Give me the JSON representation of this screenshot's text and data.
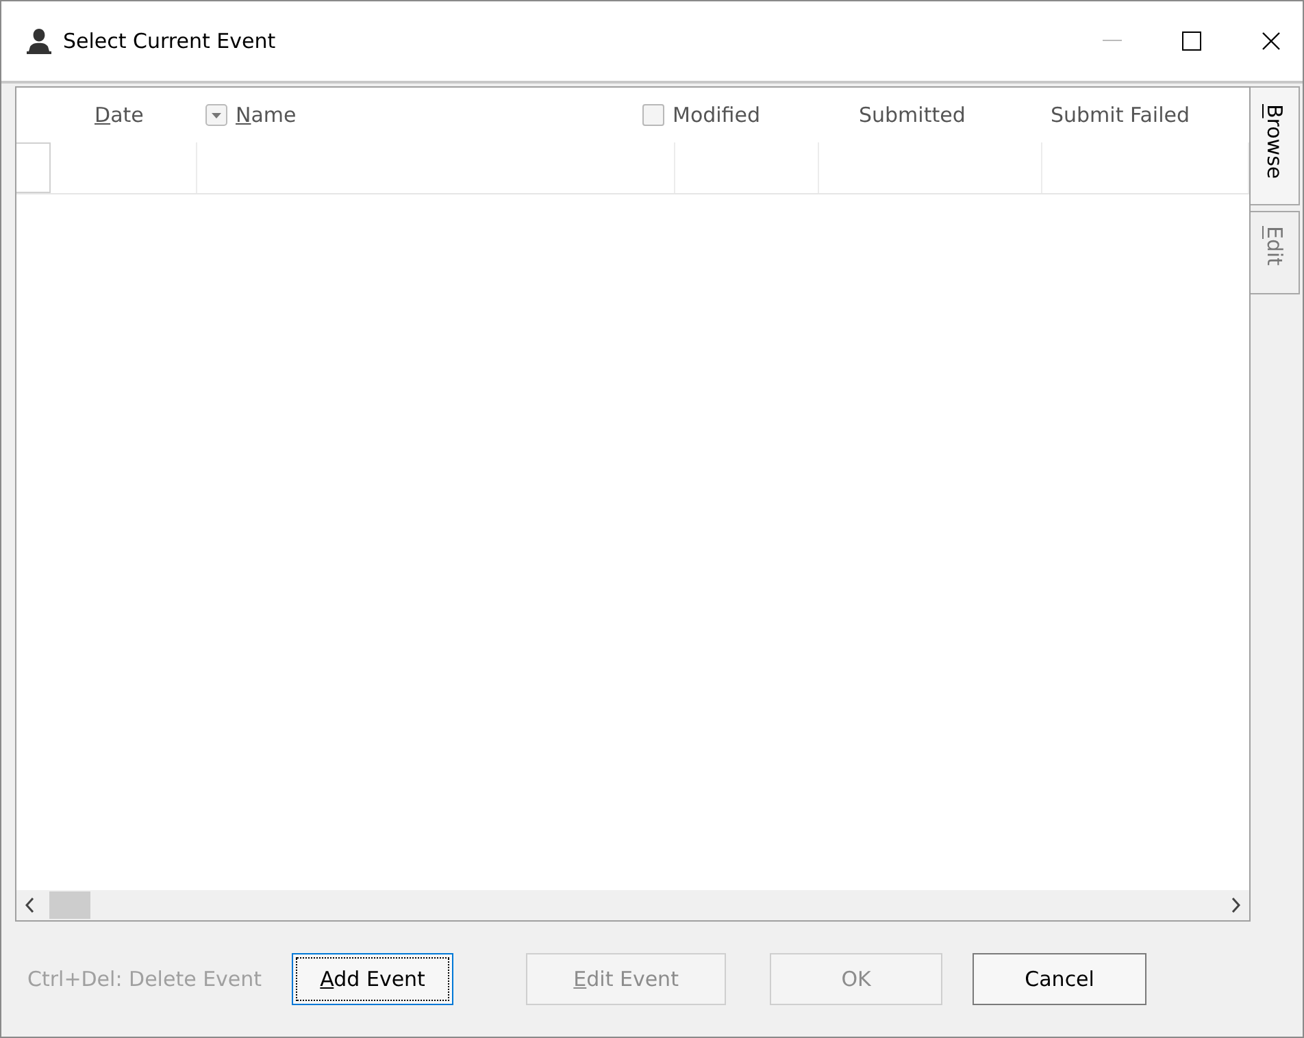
{
  "window": {
    "title": "Select Current Event"
  },
  "table": {
    "columns": [
      {
        "label": "Date",
        "kind": "text",
        "access_key": true
      },
      {
        "label": "Name",
        "kind": "dropdown",
        "access_key": true
      },
      {
        "label": "Modified",
        "kind": "checkbox",
        "checked": false,
        "access_key": false
      },
      {
        "label": "Submitted",
        "kind": "text",
        "access_key": false
      },
      {
        "label": "Submit Failed",
        "kind": "text",
        "access_key": false
      }
    ]
  },
  "side_tabs": [
    {
      "label": "Browse",
      "selected": true,
      "access_key": true
    },
    {
      "label": "Edit",
      "selected": false,
      "access_key": true
    }
  ],
  "hint": "Ctrl+Del: Delete Event",
  "buttons": [
    {
      "label": "Add Event",
      "access_key": true,
      "disabled": false,
      "focused": true
    },
    {
      "label": "Edit Event",
      "access_key": true,
      "disabled": true,
      "focused": false
    },
    {
      "label": "OK",
      "access_key": false,
      "disabled": true,
      "focused": false
    },
    {
      "label": "Cancel",
      "access_key": false,
      "disabled": false,
      "focused": false
    }
  ]
}
